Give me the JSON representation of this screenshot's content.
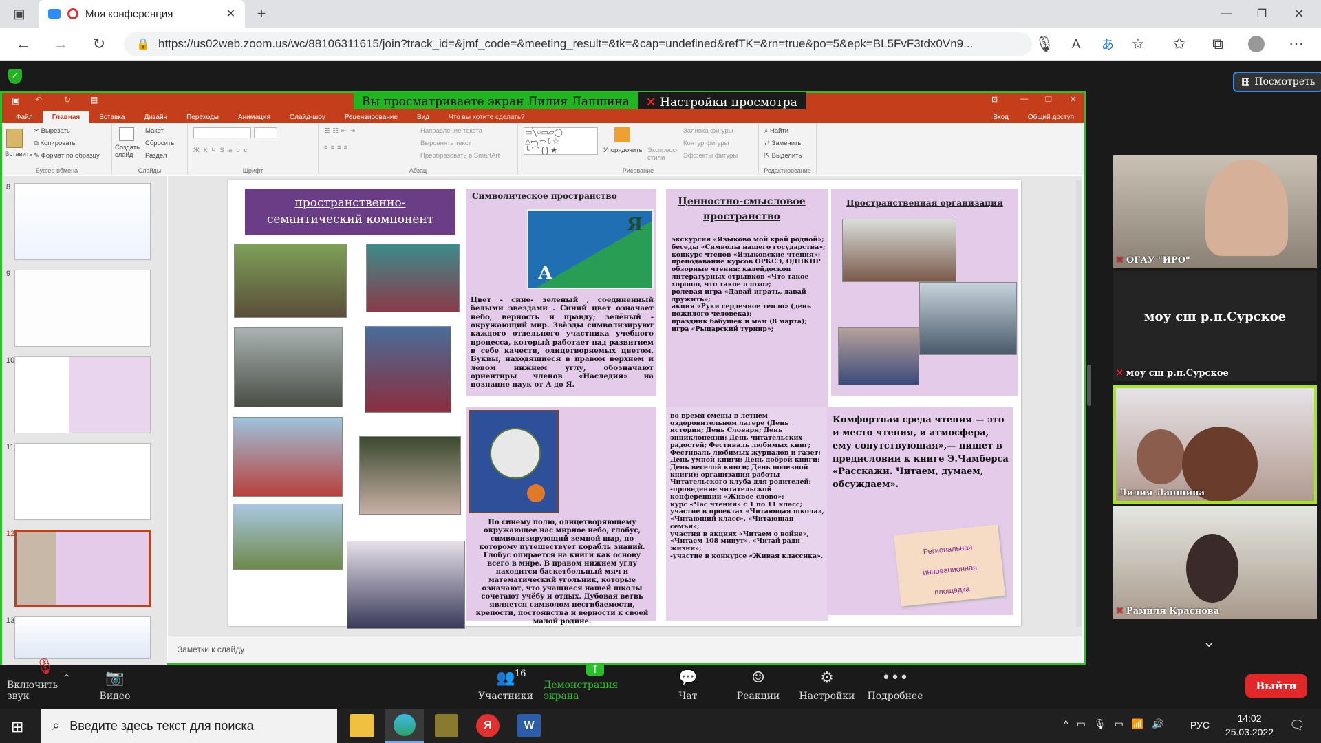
{
  "browser": {
    "tab_title": "Моя конференция",
    "url": "https://us02web.zoom.us/wc/88106311615/join?track_id=&jmf_code=&meeting_result=&tk=&cap=undefined&refTK=&rn=true&po=5&epk=BL5FvF3tdx0Vn9..."
  },
  "zoom": {
    "view_button": "Посмотреть",
    "banner_viewing": "Вы просматриваете экран Лилия Лапшина",
    "banner_settings": "Настройки просмотра",
    "participants": [
      {
        "name": "ОГАУ \"ИРО\""
      },
      {
        "name": "моу сш р.п.Сурское",
        "center_text": "моу сш р.п.Сурское"
      },
      {
        "name": "Лилия Лапшина"
      },
      {
        "name": "Рамиля Краснова"
      }
    ],
    "toolbar": {
      "audio": "Включить звук",
      "video": "Видео",
      "participants": "Участники",
      "participants_count": "16",
      "share": "Демонстрация экрана",
      "chat": "Чат",
      "reactions": "Реакции",
      "settings": "Настройки",
      "more": "Подробнее",
      "leave": "Выйти"
    }
  },
  "ppt": {
    "account": "Вход",
    "share": "Общий доступ",
    "tabs": [
      "Файл",
      "Главная",
      "Вставка",
      "Дизайн",
      "Переходы",
      "Анимация",
      "Слайд-шоу",
      "Рецензирование",
      "Вид",
      "Что вы хотите сделать?"
    ],
    "ribbon": {
      "clipboard": {
        "paste": "Вставить",
        "cut": "Вырезать",
        "copy": "Копировать",
        "format": "Формат по образцу",
        "label": "Буфер обмена"
      },
      "slides": {
        "create": "Создать слайд",
        "layout": "Макет",
        "reset": "Сбросить",
        "section": "Раздел",
        "label": "Слайды"
      },
      "font": {
        "label": "Шрифт"
      },
      "paragraph": {
        "direction": "Направление текста",
        "align": "Выровнять текст",
        "smartart": "Преобразовать в SmartArt",
        "label": "Абзац"
      },
      "drawing": {
        "arrange": "Упорядочить",
        "styles": "Экспресс-стили",
        "fill": "Заливка фигуры",
        "outline": "Контур фигуры",
        "effects": "Эффекты фигуры",
        "label": "Рисование"
      },
      "editing": {
        "find": "Найти",
        "replace": "Заменить",
        "select": "Выделить",
        "label": "Редактирование"
      }
    },
    "slide_numbers": [
      "8",
      "9",
      "10",
      "11",
      "12",
      "13"
    ],
    "notes_placeholder": "Заметки к слайду"
  },
  "slide": {
    "title": "пространственно-семантический компонент",
    "symbolic_title": "Символическое пространство",
    "flag_letters": [
      "Я",
      "А"
    ],
    "symbolic_text": "Цвет - сине- зеленый , соединенный  белыми звездами . Синий цвет означает небо, верность и правду; зелёный - окружающий мир. Звёзды символизируют каждого отдельного участника учебного процесса, который работает над развитием в себе качеств, олицетворяемых цветом. Буквы, находящиеся в правом верхнем и левом нижнем углу, обозначают ориентиры членов «Наследия» на познание наук от А до Я.",
    "emblem_text": "По синему полю, олицетворяющему окружающее нас мирное небо, глобус, символизирующий земной шар, по которому путешествует корабль знаний. Глобус опирается на  книги как основу всего в мире. В правом нижнем углу находится баскетбольный мяч и математический угольник, которые означают, что учащиеся нашей школы сочетают учёбу и отдых. Дубовая ветвь является символом несгибаемости, крепости, постоянства и верности к своей малой родине.",
    "value_title": "Ценностно-смысловое пространство",
    "value_text": "экскурсия «Языково мой край родной»;\nбеседы «Символы нашего государства»;\nконкурс чтецов «Языковские чтения»;\nпреподавание курсов ОРКСЭ, ОДНКНР\nобзорные чтения: калейдоскоп литературных отрывков «Что такое хорошо, что такое плохо»;\nролевая игра «Давай играть, давай дружить»;\nакция «Руки сердечное тепло» (день пожилого человека);\nпраздник бабушек и мам (8 марта);\nигра «Рыцарский турнир»;",
    "events_text": "во время смены в летнем оздоровительном лагере (День истории; День Словаря; День энциклопедии; День читательских радостей; Фестиваль любимых книг; Фестиваль любимых журналов и газет; День умной книги; День доброй книги; День веселой книги; День полезной книги); организация работы Читательского клуба для родителей;\n-проведение читательской конференции «Живое слово»;\nкурс «Час чтения» с 1 по 11 класс;\nучастие в проектах «Читающая школа», «Читающий класс», «Читающая семья»;\nучастия в акциях «Читаем о войне», «Читаем 108 минут», «Читай ради жизни»;\n-участие в конкурсе «Живая классика».",
    "spatial_title": "Пространственная организация",
    "reading_quote": "Комфортная среда чтения — это и место чтения, и атмосфера, ему сопутствующая»,— пишет в предисловии к книге Э.Чамберса «Расскажи. Читаем, думаем, обсуждаем».",
    "sticky_note": [
      "Региональная",
      "инновационная",
      "площадка"
    ]
  },
  "taskbar": {
    "search_placeholder": "Введите здесь текст для поиска",
    "language": "РУС",
    "time": "14:02",
    "date": "25.03.2022"
  }
}
